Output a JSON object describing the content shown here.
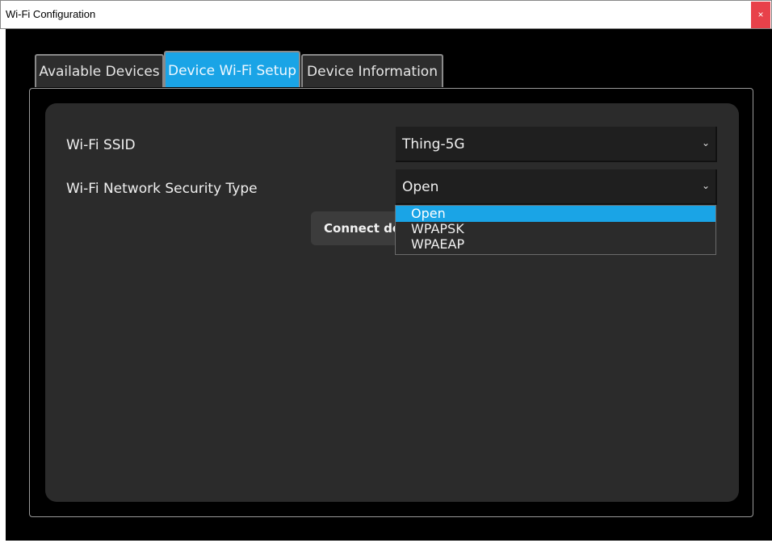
{
  "window": {
    "title": "Wi-Fi Configuration",
    "close_label": "×"
  },
  "tabs": [
    {
      "label": "Available Devices",
      "active": false
    },
    {
      "label": "Device Wi-Fi Setup",
      "active": true
    },
    {
      "label": "Device Information",
      "active": false
    }
  ],
  "form": {
    "ssid_label": "Wi-Fi SSID",
    "ssid_value": "Thing-5G",
    "security_label": "Wi-Fi Network Security Type",
    "security_value": "Open",
    "chevron": "⌄",
    "connect_label": "Connect device"
  },
  "security_dropdown": {
    "options": [
      "Open",
      "WPAPSK",
      "WPAEAP"
    ],
    "selected": "Open"
  },
  "colors": {
    "accent": "#1aa4e6",
    "close_red": "#e8414a",
    "card_bg": "#2b2b2b",
    "client_bg": "#000000"
  }
}
